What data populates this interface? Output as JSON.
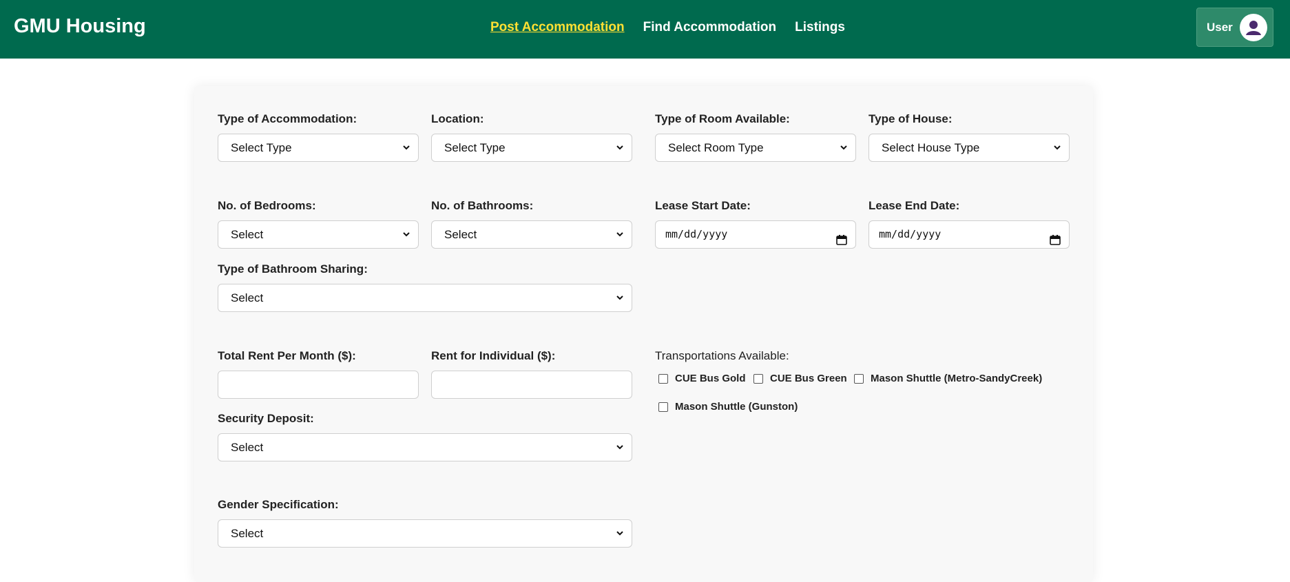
{
  "navbar": {
    "brand": "GMU Housing",
    "links": [
      {
        "label": "Post Accommodation",
        "active": true
      },
      {
        "label": "Find Accommodation",
        "active": false
      },
      {
        "label": "Listings",
        "active": false
      }
    ],
    "user_label": "User",
    "colors": {
      "background": "#006a4e",
      "active_link": "#ffe033"
    }
  },
  "form": {
    "type_of_accommodation": {
      "label": "Type of Accommodation:",
      "value": "Select Type"
    },
    "location": {
      "label": "Location:",
      "value": "Select Type"
    },
    "type_of_room": {
      "label": "Type of Room Available:",
      "value": "Select Room Type"
    },
    "type_of_house": {
      "label": "Type of House:",
      "value": "Select House Type"
    },
    "bedrooms": {
      "label": "No. of Bedrooms:",
      "value": "Select"
    },
    "bathrooms": {
      "label": "No. of Bathrooms:",
      "value": "Select"
    },
    "lease_start": {
      "label": "Lease Start Date:",
      "placeholder": "mm/dd/yyyy"
    },
    "lease_end": {
      "label": "Lease End Date:",
      "placeholder": "mm/dd/yyyy"
    },
    "bathroom_sharing": {
      "label": "Type of Bathroom Sharing:",
      "value": "Select"
    },
    "total_rent": {
      "label": "Total Rent Per Month ($):",
      "value": ""
    },
    "individual_rent": {
      "label": "Rent for Individual ($):",
      "value": ""
    },
    "security_deposit": {
      "label": "Security Deposit:",
      "value": "Select"
    },
    "gender": {
      "label": "Gender Specification:",
      "value": "Select"
    },
    "transportation": {
      "label": "Transportations Available:",
      "options": [
        {
          "label": "CUE Bus Gold",
          "checked": false
        },
        {
          "label": "CUE Bus Green",
          "checked": false
        },
        {
          "label": "Mason Shuttle (Metro-SandyCreek)",
          "checked": false
        },
        {
          "label": "Mason Shuttle (Gunston)",
          "checked": false
        }
      ]
    }
  }
}
